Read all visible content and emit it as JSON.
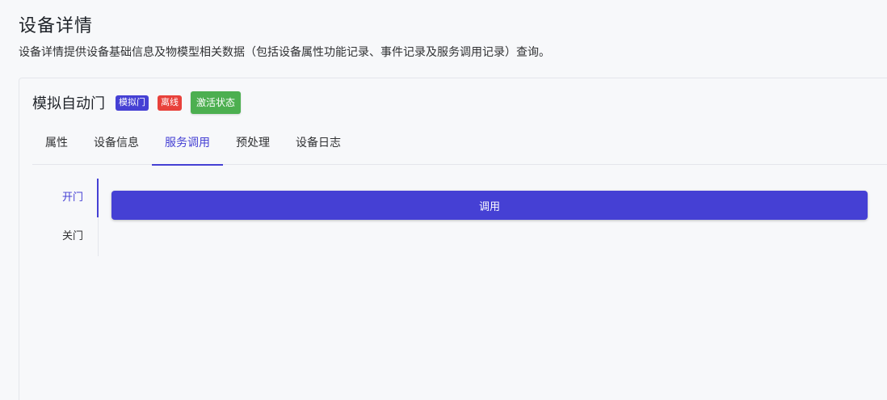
{
  "page": {
    "title": "设备详情",
    "description": "设备详情提供设备基础信息及物模型相关数据（包括设备属性功能记录、事件记录及服务调用记录）查询。"
  },
  "device": {
    "name": "模拟自动门",
    "tags": {
      "model": "模拟门",
      "status": "离线",
      "activation": "激活状态"
    }
  },
  "tabs": [
    {
      "label": "属性",
      "active": false
    },
    {
      "label": "设备信息",
      "active": false
    },
    {
      "label": "服务调用",
      "active": true
    },
    {
      "label": "预处理",
      "active": false
    },
    {
      "label": "设备日志",
      "active": false
    }
  ],
  "services": [
    {
      "label": "开门",
      "active": true
    },
    {
      "label": "关门",
      "active": false
    }
  ],
  "invoke": {
    "label": "调用"
  },
  "colors": {
    "accent": "#4540d4",
    "offline": "#e8413b",
    "active": "#4caf50",
    "background": "#f7f8fa"
  }
}
